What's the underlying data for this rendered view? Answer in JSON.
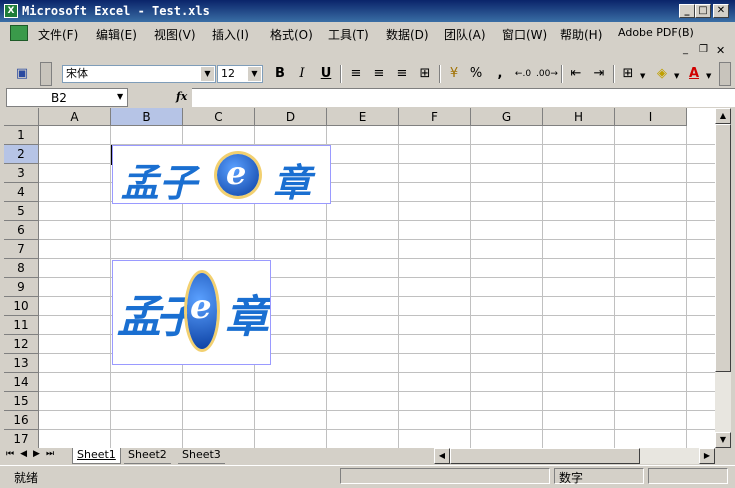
{
  "window": {
    "title": "Microsoft Excel - Test.xls"
  },
  "menu": {
    "items": [
      "文件(F)",
      "编辑(E)",
      "视图(V)",
      "插入(I)",
      "格式(O)",
      "工具(T)",
      "数据(D)",
      "团队(A)",
      "窗口(W)",
      "帮助(H)",
      "Adobe PDF(B)"
    ]
  },
  "toolbar": {
    "font_name": "宋体",
    "font_size": "12",
    "bold": "B",
    "italic": "I",
    "underline": "U",
    "percent": "%",
    "comma": ",",
    "font_color_glyph": "A"
  },
  "formula_bar": {
    "name_box": "B2",
    "fx_label": "fx",
    "content": ""
  },
  "grid": {
    "columns": [
      "A",
      "B",
      "C",
      "D",
      "E",
      "F",
      "G",
      "H",
      "I"
    ],
    "rows": [
      "1",
      "2",
      "3",
      "4",
      "5",
      "6",
      "7",
      "8",
      "9",
      "10",
      "11",
      "12",
      "13",
      "14",
      "15",
      "16",
      "17"
    ],
    "selected_cell": "B2"
  },
  "pictures": [
    {
      "text_left": "孟子",
      "text_right": "章",
      "emblem": "e"
    },
    {
      "text_left": "孟子",
      "text_right": "章",
      "emblem": "e"
    }
  ],
  "sheets": [
    "Sheet1",
    "Sheet2",
    "Sheet3"
  ],
  "status": {
    "left": "就绪",
    "mode": "数字"
  }
}
